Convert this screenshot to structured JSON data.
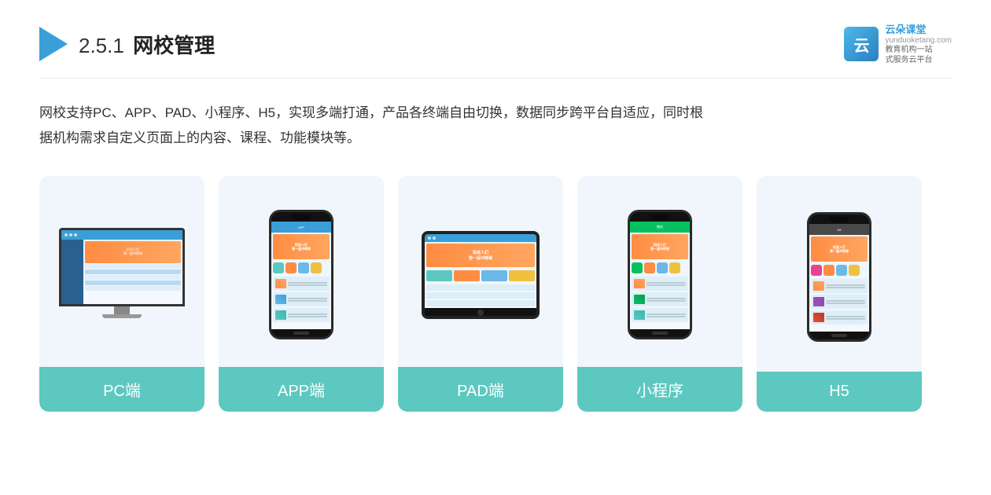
{
  "header": {
    "section_number": "2.5.1",
    "title": "网校管理",
    "brand": {
      "name": "云朵课堂",
      "domain": "yunduoketang.com",
      "subtitle_line1": "教育机构一站",
      "subtitle_line2": "式服务云平台"
    }
  },
  "description": {
    "text": "网校支持PC、APP、PAD、小程序、H5，实现多端打通，产品各终端自由切换，数据同步跨平台自适应，同时根据机构需求自定义页面上的内容、课程、功能模块等。"
  },
  "cards": [
    {
      "id": "pc",
      "label": "PC端"
    },
    {
      "id": "app",
      "label": "APP端"
    },
    {
      "id": "pad",
      "label": "PAD端"
    },
    {
      "id": "miniprogram",
      "label": "小程序"
    },
    {
      "id": "h5",
      "label": "H5"
    }
  ],
  "colors": {
    "card_bg": "#eef5fb",
    "label_bar": "#5dc8c0",
    "accent_orange": "#ff8c42",
    "accent_blue": "#3a9fd8",
    "triangle_blue": "#3a9fd8"
  }
}
